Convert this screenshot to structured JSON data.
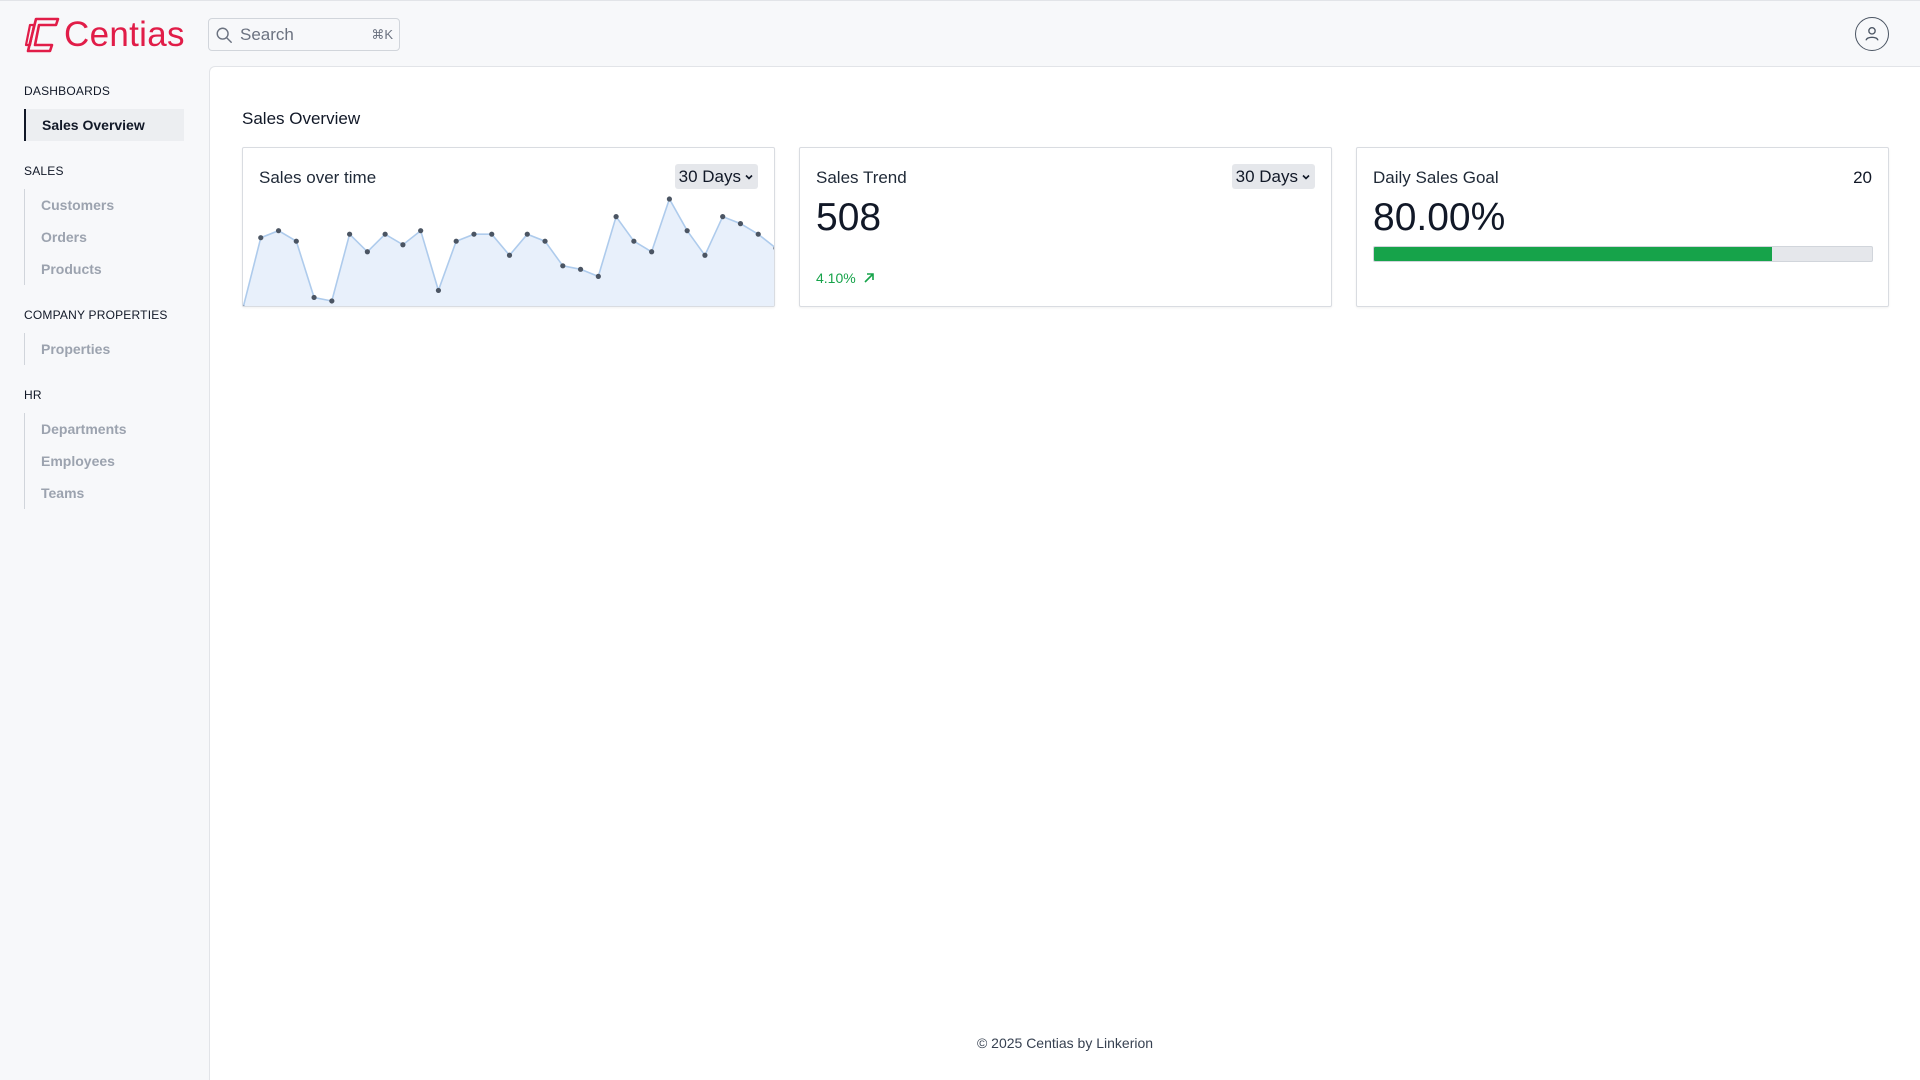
{
  "brand": {
    "name": "Centias",
    "color": "#e11d48"
  },
  "search": {
    "placeholder": "Search",
    "shortcut": "⌘K"
  },
  "sidebar": {
    "groups": [
      {
        "label": "DASHBOARDS",
        "items": [
          {
            "label": "Sales Overview",
            "active": true
          }
        ]
      },
      {
        "label": "SALES",
        "items": [
          {
            "label": "Customers"
          },
          {
            "label": "Orders"
          },
          {
            "label": "Products"
          }
        ]
      },
      {
        "label": "COMPANY PROPERTIES",
        "items": [
          {
            "label": "Properties"
          }
        ]
      },
      {
        "label": "HR",
        "items": [
          {
            "label": "Departments"
          },
          {
            "label": "Employees"
          },
          {
            "label": "Teams"
          }
        ]
      }
    ]
  },
  "page": {
    "title": "Sales Overview"
  },
  "cards": {
    "sales_over_time": {
      "title": "Sales over time",
      "range": "30 Days"
    },
    "sales_trend": {
      "title": "Sales Trend",
      "range": "30 Days",
      "value": "508",
      "change": "4.10%",
      "change_color": "#16a34a"
    },
    "daily_goal": {
      "title": "Daily Sales Goal",
      "target": "20",
      "percent_text": "80.00%",
      "progress": 0.8,
      "fill_color": "#16a34a"
    }
  },
  "chart_data": {
    "type": "area",
    "title": "Sales over time",
    "x": [
      1,
      2,
      3,
      4,
      5,
      6,
      7,
      8,
      9,
      10,
      11,
      12,
      13,
      14,
      15,
      16,
      17,
      18,
      19,
      20,
      21,
      22,
      23,
      24,
      25,
      26,
      27,
      28,
      29,
      30,
      31
    ],
    "values": [
      0,
      20,
      22,
      19,
      3,
      2,
      21,
      16,
      21,
      18,
      22,
      5,
      19,
      21,
      21,
      15,
      21,
      19,
      12,
      11,
      9,
      26,
      19,
      16,
      31,
      22,
      15,
      26,
      24,
      21,
      17
    ],
    "ylim": [
      0,
      33
    ],
    "colors": {
      "line": "#aecbec",
      "fill": "#e8f0fb",
      "point": "#4b5563"
    }
  },
  "footer": {
    "text": "© 2025 Centias by Linkerion"
  }
}
